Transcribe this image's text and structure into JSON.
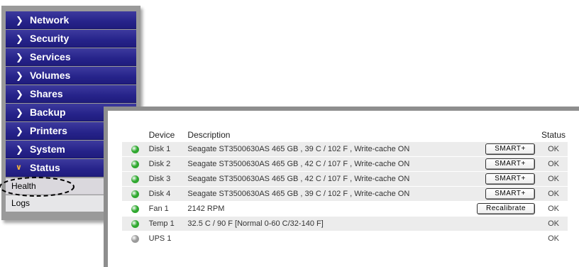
{
  "sidebar": {
    "items": [
      {
        "label": "Network",
        "expanded": false
      },
      {
        "label": "Security",
        "expanded": false
      },
      {
        "label": "Services",
        "expanded": false
      },
      {
        "label": "Volumes",
        "expanded": false
      },
      {
        "label": "Shares",
        "expanded": false
      },
      {
        "label": "Backup",
        "expanded": false
      },
      {
        "label": "Printers",
        "expanded": false
      },
      {
        "label": "System",
        "expanded": false
      },
      {
        "label": "Status",
        "expanded": true
      }
    ],
    "sub_items": [
      {
        "label": "Health",
        "selected": true
      },
      {
        "label": "Logs",
        "selected": false
      }
    ],
    "colors": {
      "nav_bg": "#26238a",
      "expanded_chevron": "#f2b13c"
    }
  },
  "health": {
    "columns": {
      "device": "Device",
      "description": "Description",
      "status": "Status"
    },
    "rows": [
      {
        "led_color": "#2fa82f",
        "device": "Disk 1",
        "description": "Seagate ST3500630AS 465 GB , 39 C / 102 F , Write-cache ON",
        "action": "SMART+",
        "status": "OK"
      },
      {
        "led_color": "#2fa82f",
        "device": "Disk 2",
        "description": "Seagate ST3500630AS 465 GB , 42 C / 107 F , Write-cache ON",
        "action": "SMART+",
        "status": "OK"
      },
      {
        "led_color": "#2fa82f",
        "device": "Disk 3",
        "description": "Seagate ST3500630AS 465 GB , 42 C / 107 F , Write-cache ON",
        "action": "SMART+",
        "status": "OK"
      },
      {
        "led_color": "#2fa82f",
        "device": "Disk 4",
        "description": "Seagate ST3500630AS 465 GB , 39 C / 102 F , Write-cache ON",
        "action": "SMART+",
        "status": "OK"
      },
      {
        "led_color": "#2fa82f",
        "device": "Fan 1",
        "description": "2142 RPM",
        "action": "Recalibrate",
        "status": "OK"
      },
      {
        "led_color": "#2fa82f",
        "device": "Temp 1",
        "description": "32.5 C / 90 F [Normal 0-60 C/32-140 F]",
        "action": "",
        "status": "OK"
      },
      {
        "led_color": "#9a9a9a",
        "device": "UPS 1",
        "description": "",
        "action": "",
        "status": "OK"
      }
    ]
  }
}
